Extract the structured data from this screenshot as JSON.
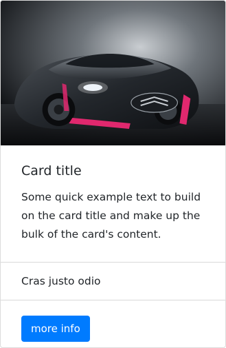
{
  "card": {
    "image_alt": "car-image",
    "title": "Card title",
    "text": "Some quick example text to build on the card title and make up the bulk of the card's content.",
    "list_item": "Cras justo odio",
    "button_label": "more info",
    "colors": {
      "button": "#007bff",
      "text": "#212529",
      "border": "#d9d9d9",
      "car_accent": "#e0286e"
    }
  }
}
